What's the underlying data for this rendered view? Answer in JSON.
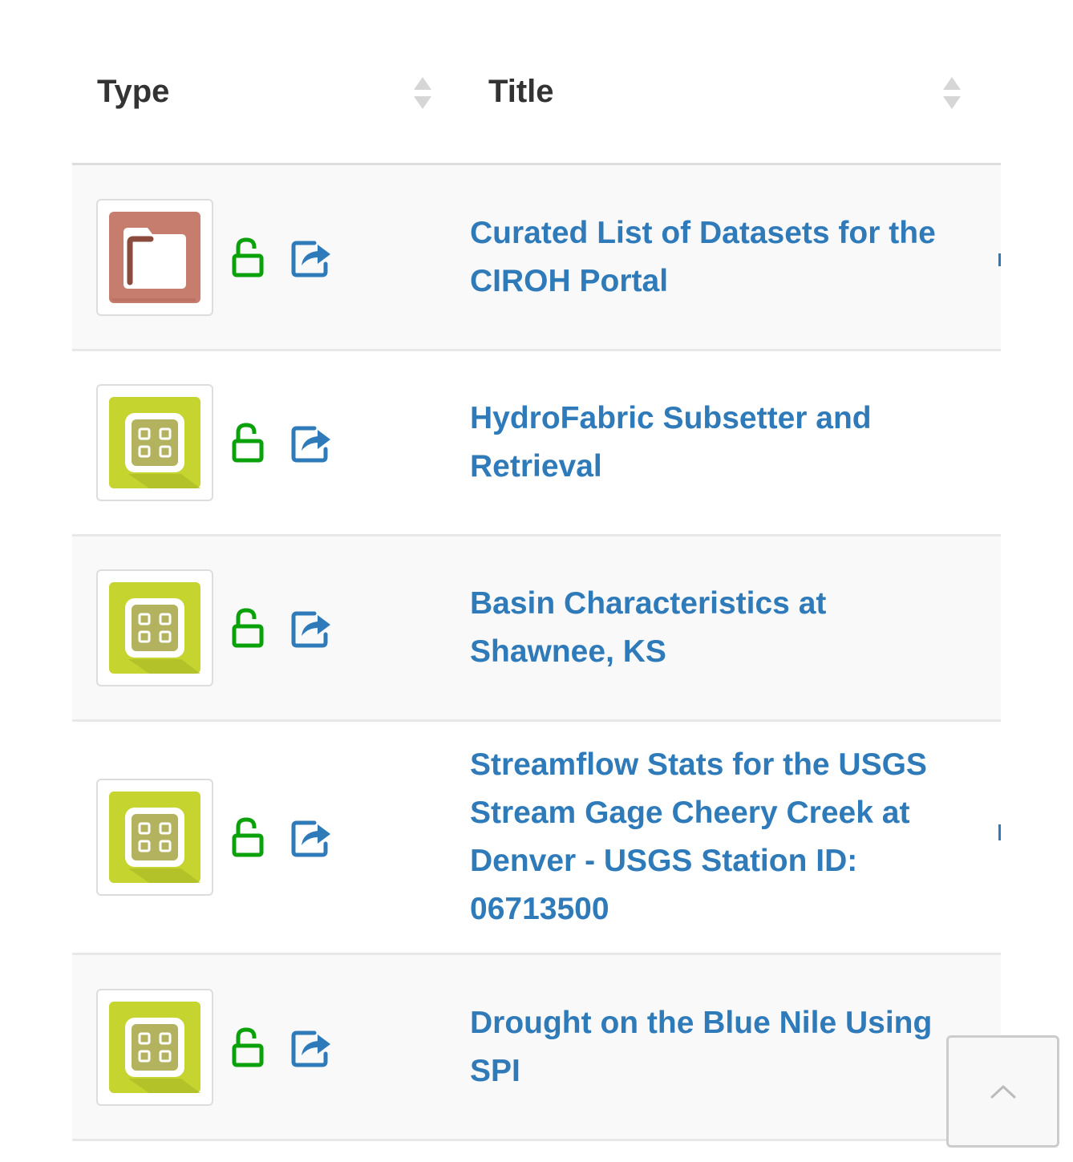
{
  "table": {
    "headers": {
      "type": "Type",
      "title": "Title"
    },
    "rows": [
      {
        "resource_type": "collection",
        "type_icon": "folder-icon",
        "type_icon_color": "#c67d6d",
        "access_icon": "unlocked-icon",
        "share_icon": "share-icon",
        "title": "Curated List of Datasets for the CIROH Portal"
      },
      {
        "resource_type": "app",
        "type_icon": "web-app-icon",
        "type_icon_color": "#c6d42f",
        "access_icon": "unlocked-icon",
        "share_icon": "share-icon",
        "title": "HydroFabric Subsetter and Retrieval"
      },
      {
        "resource_type": "app",
        "type_icon": "web-app-icon",
        "type_icon_color": "#c6d42f",
        "access_icon": "unlocked-icon",
        "share_icon": "share-icon",
        "title": "Basin Characteristics at Shawnee, KS"
      },
      {
        "resource_type": "app",
        "type_icon": "web-app-icon",
        "type_icon_color": "#c6d42f",
        "access_icon": "unlocked-icon",
        "share_icon": "share-icon",
        "title": "Streamflow Stats for the USGS Stream Gage Cheery Creek at Denver - USGS Station ID: 06713500"
      },
      {
        "resource_type": "app",
        "type_icon": "web-app-icon",
        "type_icon_color": "#c6d42f",
        "access_icon": "unlocked-icon",
        "share_icon": "share-icon",
        "title": "Drought on the Blue Nile Using SPI"
      }
    ]
  },
  "colors": {
    "link": "#2f7ab9",
    "unlocked": "#0aa10a",
    "share": "#2f7ab9",
    "header_text": "#333333",
    "row_stripe": "#f9f9f9"
  },
  "scroll_to_top": {
    "icon": "chevron-up-icon"
  }
}
